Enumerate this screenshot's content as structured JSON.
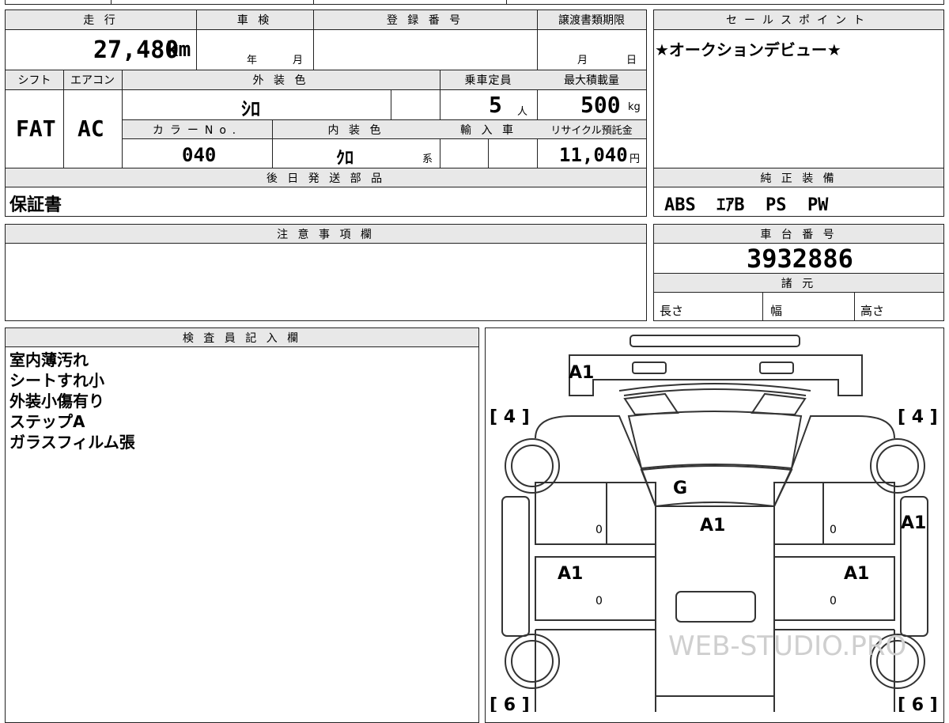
{
  "headers": {
    "mileage": "走 行",
    "inspection": "車 検",
    "registration": "登 録 番 号",
    "transfer_deadline": "譲渡書類期限",
    "sales_point": "セールスポイント",
    "shift": "シフト",
    "aircon": "エアコン",
    "exterior_color": "外 装 色",
    "capacity": "乗車定員",
    "max_load": "最大積載量",
    "color_no": "カラーNo.",
    "interior_color": "内 装 色",
    "import": "輸 入 車",
    "recycle": "リサイクル預託金",
    "later_parts": "後 日 発 送 部 品",
    "equipment": "純 正 装 備",
    "notes": "注 意 事 項 欄",
    "chassis": "車 台 番 号",
    "specs": "諸 元",
    "inspector": "検 査 員 記 入 欄"
  },
  "values": {
    "mileage": "27,480",
    "mileage_unit": "km",
    "year_unit": "年",
    "month_unit": "月",
    "deadline_month": "月",
    "deadline_day": "日",
    "sales_point": "★オークションデビュー★",
    "shift": "FAT",
    "aircon": "AC",
    "exterior_color": "ｼﾛ",
    "capacity": "5",
    "capacity_unit": "人",
    "max_load": "500",
    "max_load_unit": "kg",
    "color_no": "040",
    "interior_color": "ｸﾛ",
    "interior_suffix": "系",
    "recycle": "11,040",
    "recycle_unit": "円",
    "later_parts": "保証書",
    "equipment": "ABS  ｴｱB  PS  PW",
    "chassis": "3932886",
    "spec_length": "長さ",
    "spec_width": "幅",
    "spec_height": "高さ"
  },
  "inspector_notes": [
    "室内薄汚れ",
    "シートすれ小",
    "外装小傷有り",
    "ステップA",
    "ガラスフィルム張"
  ],
  "diagram": {
    "tag_a1_top": "A1",
    "tag_g": "G",
    "tag_a1_roof": "A1",
    "tag_a1_right": "A1",
    "tag_a1_left_door": "A1",
    "tag_a1_right_door": "A1",
    "bracket_front_left": "[ 4 ]",
    "bracket_front_right": "[ 4 ]",
    "bracket_rear_left": "[ 6 ]",
    "bracket_rear_right": "[ 6 ]",
    "door_mark_1": "0",
    "door_mark_2": "0",
    "door_mark_3": "0",
    "door_mark_4": "0",
    "watermark": "WEB-STUDIO.PRO"
  }
}
